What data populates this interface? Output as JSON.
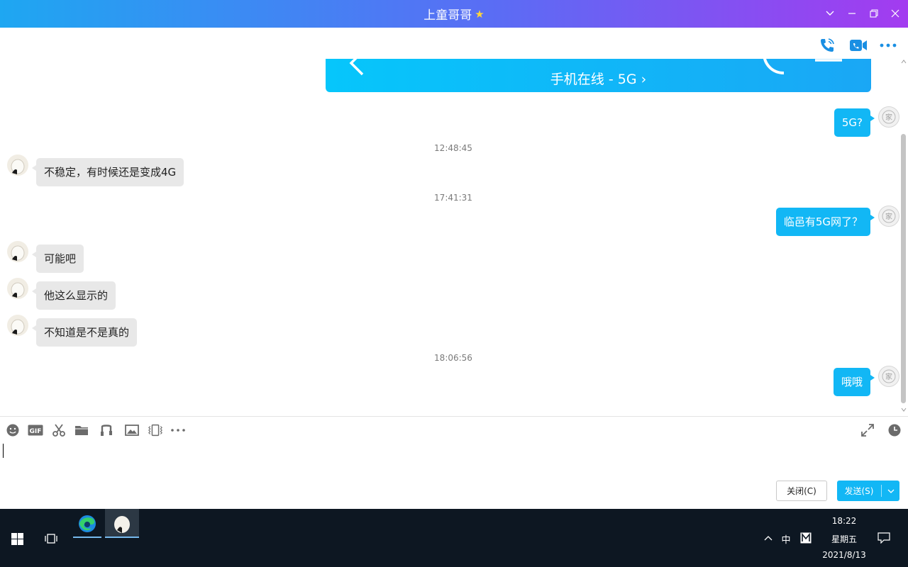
{
  "window": {
    "title": "上童哥哥",
    "star_icon": "star-icon",
    "controls": [
      "chevron-down-icon",
      "minimize-icon",
      "restore-icon",
      "close-icon"
    ]
  },
  "header": {
    "icons": [
      "voice-call-icon",
      "video-call-icon",
      "more-icon"
    ]
  },
  "banner": {
    "subtitle": "手机在线 - 5G ›"
  },
  "messages": [
    {
      "side": "right",
      "text": "5G?"
    },
    {
      "time": "12:48:45"
    },
    {
      "side": "left",
      "text": "不稳定，有时候还是变成4G"
    },
    {
      "time": "17:41:31"
    },
    {
      "side": "right",
      "text": "临邑有5G网了？"
    },
    {
      "side": "left",
      "text": "可能吧"
    },
    {
      "side": "left",
      "text": "他这么显示的"
    },
    {
      "side": "left",
      "text": "不知道是不是真的"
    },
    {
      "time": "18:06:56"
    },
    {
      "side": "right",
      "text": "哦哦"
    }
  ],
  "toolbar": {
    "icons": [
      "emoji-icon",
      "gif-icon",
      "scissors-icon",
      "folder-icon",
      "music-icon",
      "image-icon",
      "shake-icon",
      "more-icon",
      "expand-icon",
      "history-icon"
    ]
  },
  "input": {
    "value": "",
    "placeholder": ""
  },
  "buttons": {
    "close": "关闭(C)",
    "send": "发送(S)"
  },
  "taskbar": {
    "time": "18:22",
    "weekday": "星期五",
    "date": "2021/8/13",
    "ime": "中",
    "colors": {
      "accent": "#12b7f5",
      "taskbar": "#0d1722"
    }
  }
}
